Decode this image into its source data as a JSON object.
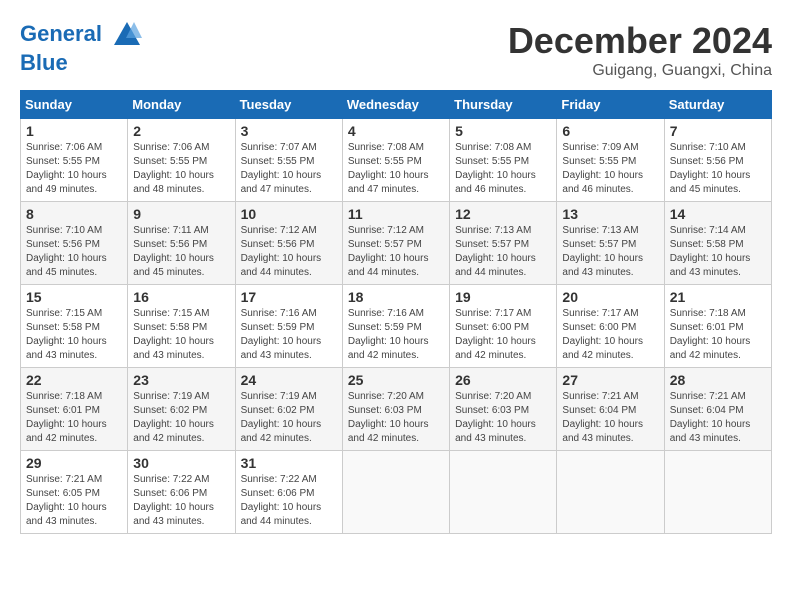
{
  "header": {
    "logo_line1": "General",
    "logo_line2": "Blue",
    "month": "December 2024",
    "location": "Guigang, Guangxi, China"
  },
  "weekdays": [
    "Sunday",
    "Monday",
    "Tuesday",
    "Wednesday",
    "Thursday",
    "Friday",
    "Saturday"
  ],
  "weeks": [
    [
      {
        "day": "1",
        "info": "Sunrise: 7:06 AM\nSunset: 5:55 PM\nDaylight: 10 hours\nand 49 minutes."
      },
      {
        "day": "2",
        "info": "Sunrise: 7:06 AM\nSunset: 5:55 PM\nDaylight: 10 hours\nand 48 minutes."
      },
      {
        "day": "3",
        "info": "Sunrise: 7:07 AM\nSunset: 5:55 PM\nDaylight: 10 hours\nand 47 minutes."
      },
      {
        "day": "4",
        "info": "Sunrise: 7:08 AM\nSunset: 5:55 PM\nDaylight: 10 hours\nand 47 minutes."
      },
      {
        "day": "5",
        "info": "Sunrise: 7:08 AM\nSunset: 5:55 PM\nDaylight: 10 hours\nand 46 minutes."
      },
      {
        "day": "6",
        "info": "Sunrise: 7:09 AM\nSunset: 5:55 PM\nDaylight: 10 hours\nand 46 minutes."
      },
      {
        "day": "7",
        "info": "Sunrise: 7:10 AM\nSunset: 5:56 PM\nDaylight: 10 hours\nand 45 minutes."
      }
    ],
    [
      {
        "day": "8",
        "info": "Sunrise: 7:10 AM\nSunset: 5:56 PM\nDaylight: 10 hours\nand 45 minutes."
      },
      {
        "day": "9",
        "info": "Sunrise: 7:11 AM\nSunset: 5:56 PM\nDaylight: 10 hours\nand 45 minutes."
      },
      {
        "day": "10",
        "info": "Sunrise: 7:12 AM\nSunset: 5:56 PM\nDaylight: 10 hours\nand 44 minutes."
      },
      {
        "day": "11",
        "info": "Sunrise: 7:12 AM\nSunset: 5:57 PM\nDaylight: 10 hours\nand 44 minutes."
      },
      {
        "day": "12",
        "info": "Sunrise: 7:13 AM\nSunset: 5:57 PM\nDaylight: 10 hours\nand 44 minutes."
      },
      {
        "day": "13",
        "info": "Sunrise: 7:13 AM\nSunset: 5:57 PM\nDaylight: 10 hours\nand 43 minutes."
      },
      {
        "day": "14",
        "info": "Sunrise: 7:14 AM\nSunset: 5:58 PM\nDaylight: 10 hours\nand 43 minutes."
      }
    ],
    [
      {
        "day": "15",
        "info": "Sunrise: 7:15 AM\nSunset: 5:58 PM\nDaylight: 10 hours\nand 43 minutes."
      },
      {
        "day": "16",
        "info": "Sunrise: 7:15 AM\nSunset: 5:58 PM\nDaylight: 10 hours\nand 43 minutes."
      },
      {
        "day": "17",
        "info": "Sunrise: 7:16 AM\nSunset: 5:59 PM\nDaylight: 10 hours\nand 43 minutes."
      },
      {
        "day": "18",
        "info": "Sunrise: 7:16 AM\nSunset: 5:59 PM\nDaylight: 10 hours\nand 42 minutes."
      },
      {
        "day": "19",
        "info": "Sunrise: 7:17 AM\nSunset: 6:00 PM\nDaylight: 10 hours\nand 42 minutes."
      },
      {
        "day": "20",
        "info": "Sunrise: 7:17 AM\nSunset: 6:00 PM\nDaylight: 10 hours\nand 42 minutes."
      },
      {
        "day": "21",
        "info": "Sunrise: 7:18 AM\nSunset: 6:01 PM\nDaylight: 10 hours\nand 42 minutes."
      }
    ],
    [
      {
        "day": "22",
        "info": "Sunrise: 7:18 AM\nSunset: 6:01 PM\nDaylight: 10 hours\nand 42 minutes."
      },
      {
        "day": "23",
        "info": "Sunrise: 7:19 AM\nSunset: 6:02 PM\nDaylight: 10 hours\nand 42 minutes."
      },
      {
        "day": "24",
        "info": "Sunrise: 7:19 AM\nSunset: 6:02 PM\nDaylight: 10 hours\nand 42 minutes."
      },
      {
        "day": "25",
        "info": "Sunrise: 7:20 AM\nSunset: 6:03 PM\nDaylight: 10 hours\nand 42 minutes."
      },
      {
        "day": "26",
        "info": "Sunrise: 7:20 AM\nSunset: 6:03 PM\nDaylight: 10 hours\nand 43 minutes."
      },
      {
        "day": "27",
        "info": "Sunrise: 7:21 AM\nSunset: 6:04 PM\nDaylight: 10 hours\nand 43 minutes."
      },
      {
        "day": "28",
        "info": "Sunrise: 7:21 AM\nSunset: 6:04 PM\nDaylight: 10 hours\nand 43 minutes."
      }
    ],
    [
      {
        "day": "29",
        "info": "Sunrise: 7:21 AM\nSunset: 6:05 PM\nDaylight: 10 hours\nand 43 minutes."
      },
      {
        "day": "30",
        "info": "Sunrise: 7:22 AM\nSunset: 6:06 PM\nDaylight: 10 hours\nand 43 minutes."
      },
      {
        "day": "31",
        "info": "Sunrise: 7:22 AM\nSunset: 6:06 PM\nDaylight: 10 hours\nand 44 minutes."
      },
      {
        "day": "",
        "info": ""
      },
      {
        "day": "",
        "info": ""
      },
      {
        "day": "",
        "info": ""
      },
      {
        "day": "",
        "info": ""
      }
    ]
  ]
}
